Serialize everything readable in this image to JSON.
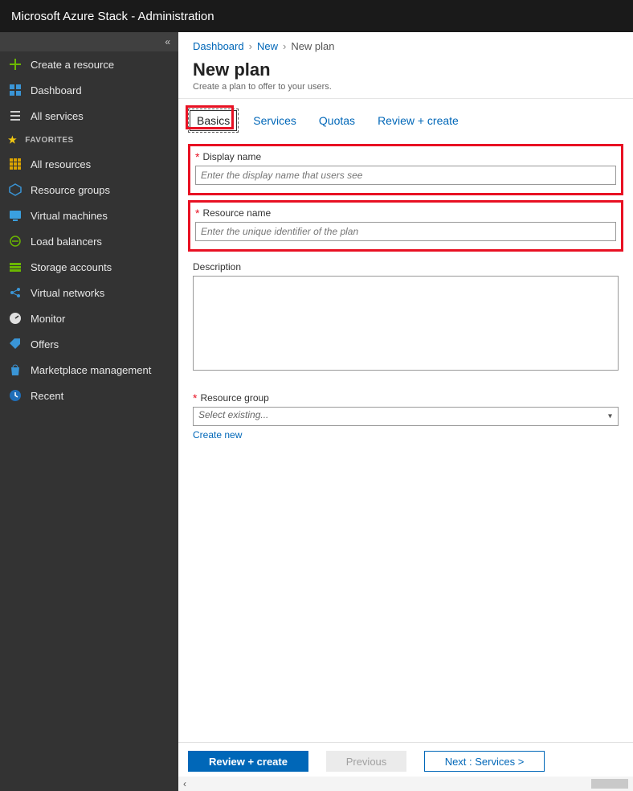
{
  "header": {
    "title": "Microsoft Azure Stack - Administration"
  },
  "sidebar": {
    "create": "Create a resource",
    "dashboard": "Dashboard",
    "allservices": "All services",
    "favorites_label": "FAVORITES",
    "items": [
      {
        "label": "All resources"
      },
      {
        "label": "Resource groups"
      },
      {
        "label": "Virtual machines"
      },
      {
        "label": "Load balancers"
      },
      {
        "label": "Storage accounts"
      },
      {
        "label": "Virtual networks"
      },
      {
        "label": "Monitor"
      },
      {
        "label": "Offers"
      },
      {
        "label": "Marketplace management"
      },
      {
        "label": "Recent"
      }
    ]
  },
  "breadcrumbs": {
    "a": "Dashboard",
    "b": "New",
    "c": "New plan"
  },
  "page": {
    "title": "New plan",
    "subtitle": "Create a plan to offer to your users."
  },
  "tabs": {
    "basics": "Basics",
    "services": "Services",
    "quotas": "Quotas",
    "review": "Review + create"
  },
  "form": {
    "display_name_label": "Display name",
    "display_name_ph": "Enter the display name that users see",
    "resource_name_label": "Resource name",
    "resource_name_ph": "Enter the unique identifier of the plan",
    "description_label": "Description",
    "rg_label": "Resource group",
    "rg_ph": "Select existing...",
    "create_new": "Create new"
  },
  "footer": {
    "review": "Review + create",
    "previous": "Previous",
    "next": "Next : Services >"
  }
}
